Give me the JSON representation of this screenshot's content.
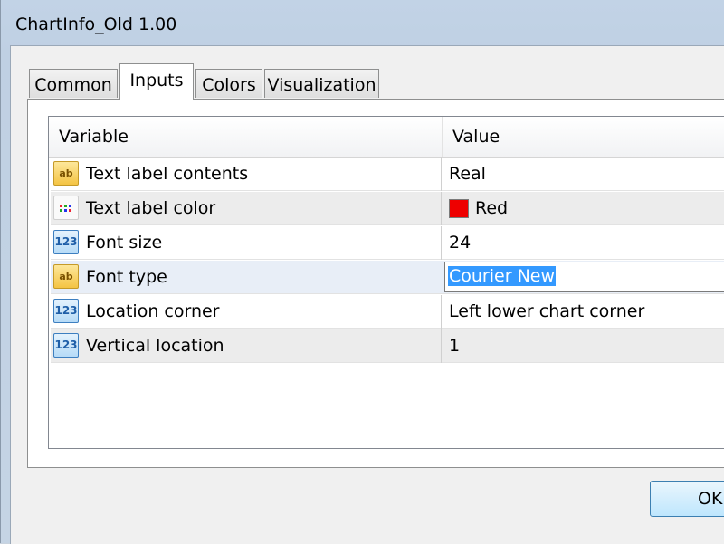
{
  "window": {
    "title": "ChartInfo_Old 1.00"
  },
  "tabs": [
    {
      "label": "Common"
    },
    {
      "label": "Inputs"
    },
    {
      "label": "Colors"
    },
    {
      "label": "Visualization"
    }
  ],
  "grid": {
    "headers": {
      "variable": "Variable",
      "value": "Value"
    },
    "rows": [
      {
        "icon": "ab",
        "variable": "Text label contents",
        "value": "Real"
      },
      {
        "icon": "clr",
        "variable": "Text label color",
        "value": "Red",
        "swatch_color": "#ee0000"
      },
      {
        "icon": "123",
        "variable": "Font size",
        "value": "24"
      },
      {
        "icon": "ab",
        "variable": "Font type",
        "value": "Courier New"
      },
      {
        "icon": "123",
        "variable": "Location corner",
        "value": "Left lower chart corner"
      },
      {
        "icon": "123",
        "variable": "Vertical location",
        "value": "1"
      }
    ]
  },
  "buttons": {
    "ok": "OK"
  }
}
